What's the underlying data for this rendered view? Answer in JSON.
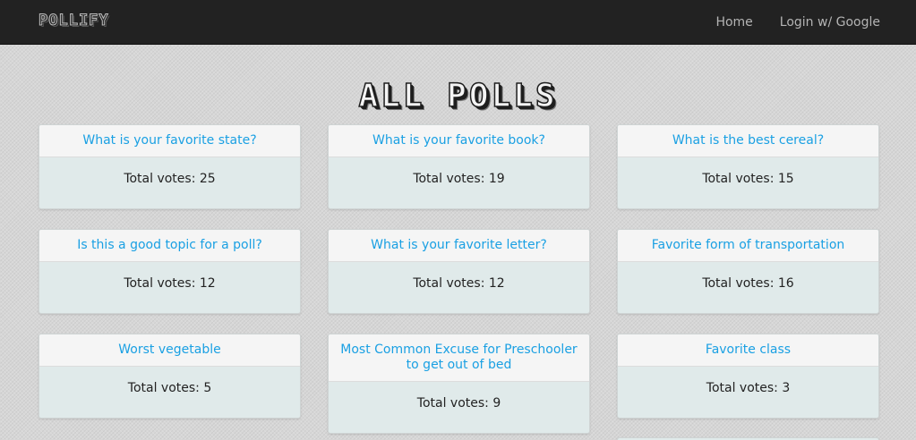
{
  "navbar": {
    "brand": "POLLIFY",
    "links": [
      "Home",
      "Login w/ Google"
    ]
  },
  "page_title": "ALL POLLS",
  "vote_prefix": "Total votes: ",
  "polls": [
    {
      "question": "What is your favorite state?",
      "votes": "Total votes: 25"
    },
    {
      "question": "What is your favorite book?",
      "votes": "Total votes: 19"
    },
    {
      "question": "What is the best cereal?",
      "votes": "Total votes: 15"
    },
    {
      "question": "Is this a good topic for a poll?",
      "votes": "Total votes: 12"
    },
    {
      "question": "What is your favorite letter?",
      "votes": "Total votes: 12"
    },
    {
      "question": "Favorite form of transportation",
      "votes": "Total votes: 16"
    },
    {
      "question": "Worst vegetable",
      "votes": "Total votes: 5"
    },
    {
      "question": "Most Common Excuse for Preschooler to get out of bed",
      "votes": "Total votes: 9"
    },
    {
      "question": "Favorite class",
      "votes": "Total votes: 3"
    }
  ],
  "colors": {
    "navbar": "#222222",
    "link": "#1aa0e3",
    "card_body": "#e0eaea"
  }
}
